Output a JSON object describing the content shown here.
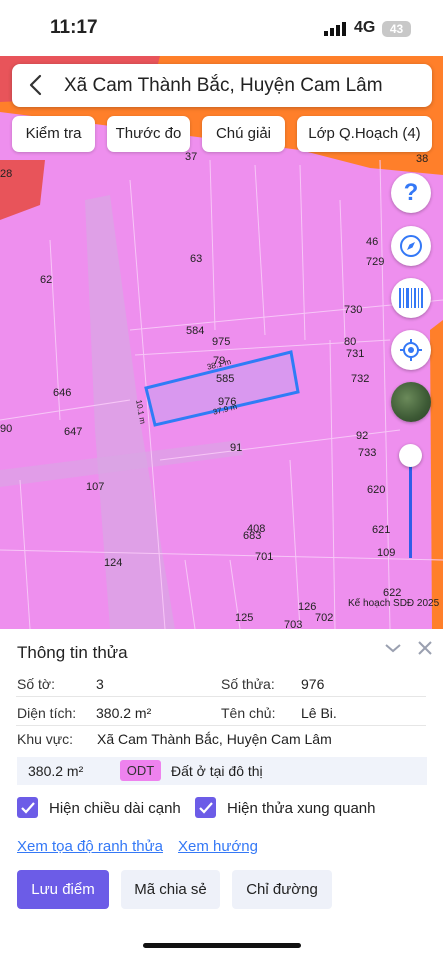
{
  "status_bar": {
    "time": "11:17",
    "network": "4G",
    "battery": "43"
  },
  "search": {
    "title": "Xã Cam Thành Bắc, Huyện Cam Lâm"
  },
  "toolbar": {
    "check": "Kiểm tra",
    "measure": "Thước đo",
    "legend": "Chú giải",
    "layer": "Lớp Q.Hoạch (4)"
  },
  "map": {
    "parcels": [
      "37",
      "63",
      "46",
      "729",
      "62",
      "730",
      "584",
      "975",
      "80",
      "731",
      "79",
      "585",
      "732",
      "976",
      "646",
      "647",
      "92",
      "733",
      "91",
      "107",
      "620",
      "408",
      "683",
      "621",
      "701",
      "109",
      "124",
      "622",
      "126",
      "702",
      "125",
      "703",
      "28",
      "38",
      "90"
    ],
    "dim_top": "38.1 m",
    "dim_bottom": "37.9 m",
    "dim_left": "10.1 m",
    "plan_label": "Kế hoạch SDĐ 2025",
    "fab_icons": [
      "help-icon",
      "compass-icon",
      "barcode-icon",
      "locate-icon",
      "satellite-icon"
    ]
  },
  "sheet": {
    "title": "Thông tin thửa",
    "so_to_label": "Số tờ:",
    "so_to_value": "3",
    "so_thua_label": "Số thửa:",
    "so_thua_value": "976",
    "dien_tich_label": "Diện tích:",
    "dien_tich_value": "380.2 m²",
    "ten_chu_label": "Tên chủ:",
    "ten_chu_value": "Lê Bi.",
    "khu_vuc_label": "Khu vực:",
    "khu_vuc_value": "Xã Cam Thành Bắc, Huyện Cam Lâm",
    "zone": {
      "area": "380.2 m²",
      "code": "ODT",
      "name": "Đất ở tại đô thị"
    },
    "check_edge": "Hiện chiều dài cạnh",
    "check_neighbor": "Hiện thửa xung quanh",
    "link_coords": "Xem tọa độ ranh thửa",
    "link_direction": "Xem hướng",
    "btn_save": "Lưu điểm",
    "btn_share": "Mã chia sẻ",
    "btn_route": "Chỉ đường"
  },
  "colors": {
    "accent": "#6c5ce7",
    "map_fill": "#ee8fee",
    "parcel_border": "#2f7cf6",
    "link": "#3478f6",
    "plan_orange": "#ff7f2a",
    "plan_red": "#e8545a"
  }
}
